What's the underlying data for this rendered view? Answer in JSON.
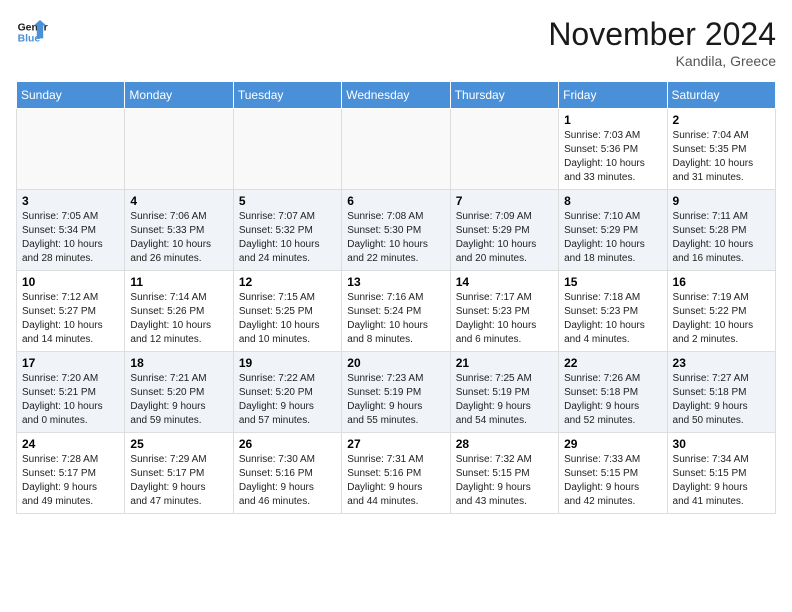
{
  "header": {
    "logo_line1": "General",
    "logo_line2": "Blue",
    "month_title": "November 2024",
    "location": "Kandila, Greece"
  },
  "days_of_week": [
    "Sunday",
    "Monday",
    "Tuesday",
    "Wednesday",
    "Thursday",
    "Friday",
    "Saturday"
  ],
  "weeks": [
    [
      {
        "day": "",
        "info": ""
      },
      {
        "day": "",
        "info": ""
      },
      {
        "day": "",
        "info": ""
      },
      {
        "day": "",
        "info": ""
      },
      {
        "day": "",
        "info": ""
      },
      {
        "day": "1",
        "info": "Sunrise: 7:03 AM\nSunset: 5:36 PM\nDaylight: 10 hours\nand 33 minutes."
      },
      {
        "day": "2",
        "info": "Sunrise: 7:04 AM\nSunset: 5:35 PM\nDaylight: 10 hours\nand 31 minutes."
      }
    ],
    [
      {
        "day": "3",
        "info": "Sunrise: 7:05 AM\nSunset: 5:34 PM\nDaylight: 10 hours\nand 28 minutes."
      },
      {
        "day": "4",
        "info": "Sunrise: 7:06 AM\nSunset: 5:33 PM\nDaylight: 10 hours\nand 26 minutes."
      },
      {
        "day": "5",
        "info": "Sunrise: 7:07 AM\nSunset: 5:32 PM\nDaylight: 10 hours\nand 24 minutes."
      },
      {
        "day": "6",
        "info": "Sunrise: 7:08 AM\nSunset: 5:30 PM\nDaylight: 10 hours\nand 22 minutes."
      },
      {
        "day": "7",
        "info": "Sunrise: 7:09 AM\nSunset: 5:29 PM\nDaylight: 10 hours\nand 20 minutes."
      },
      {
        "day": "8",
        "info": "Sunrise: 7:10 AM\nSunset: 5:29 PM\nDaylight: 10 hours\nand 18 minutes."
      },
      {
        "day": "9",
        "info": "Sunrise: 7:11 AM\nSunset: 5:28 PM\nDaylight: 10 hours\nand 16 minutes."
      }
    ],
    [
      {
        "day": "10",
        "info": "Sunrise: 7:12 AM\nSunset: 5:27 PM\nDaylight: 10 hours\nand 14 minutes."
      },
      {
        "day": "11",
        "info": "Sunrise: 7:14 AM\nSunset: 5:26 PM\nDaylight: 10 hours\nand 12 minutes."
      },
      {
        "day": "12",
        "info": "Sunrise: 7:15 AM\nSunset: 5:25 PM\nDaylight: 10 hours\nand 10 minutes."
      },
      {
        "day": "13",
        "info": "Sunrise: 7:16 AM\nSunset: 5:24 PM\nDaylight: 10 hours\nand 8 minutes."
      },
      {
        "day": "14",
        "info": "Sunrise: 7:17 AM\nSunset: 5:23 PM\nDaylight: 10 hours\nand 6 minutes."
      },
      {
        "day": "15",
        "info": "Sunrise: 7:18 AM\nSunset: 5:23 PM\nDaylight: 10 hours\nand 4 minutes."
      },
      {
        "day": "16",
        "info": "Sunrise: 7:19 AM\nSunset: 5:22 PM\nDaylight: 10 hours\nand 2 minutes."
      }
    ],
    [
      {
        "day": "17",
        "info": "Sunrise: 7:20 AM\nSunset: 5:21 PM\nDaylight: 10 hours\nand 0 minutes."
      },
      {
        "day": "18",
        "info": "Sunrise: 7:21 AM\nSunset: 5:20 PM\nDaylight: 9 hours\nand 59 minutes."
      },
      {
        "day": "19",
        "info": "Sunrise: 7:22 AM\nSunset: 5:20 PM\nDaylight: 9 hours\nand 57 minutes."
      },
      {
        "day": "20",
        "info": "Sunrise: 7:23 AM\nSunset: 5:19 PM\nDaylight: 9 hours\nand 55 minutes."
      },
      {
        "day": "21",
        "info": "Sunrise: 7:25 AM\nSunset: 5:19 PM\nDaylight: 9 hours\nand 54 minutes."
      },
      {
        "day": "22",
        "info": "Sunrise: 7:26 AM\nSunset: 5:18 PM\nDaylight: 9 hours\nand 52 minutes."
      },
      {
        "day": "23",
        "info": "Sunrise: 7:27 AM\nSunset: 5:18 PM\nDaylight: 9 hours\nand 50 minutes."
      }
    ],
    [
      {
        "day": "24",
        "info": "Sunrise: 7:28 AM\nSunset: 5:17 PM\nDaylight: 9 hours\nand 49 minutes."
      },
      {
        "day": "25",
        "info": "Sunrise: 7:29 AM\nSunset: 5:17 PM\nDaylight: 9 hours\nand 47 minutes."
      },
      {
        "day": "26",
        "info": "Sunrise: 7:30 AM\nSunset: 5:16 PM\nDaylight: 9 hours\nand 46 minutes."
      },
      {
        "day": "27",
        "info": "Sunrise: 7:31 AM\nSunset: 5:16 PM\nDaylight: 9 hours\nand 44 minutes."
      },
      {
        "day": "28",
        "info": "Sunrise: 7:32 AM\nSunset: 5:15 PM\nDaylight: 9 hours\nand 43 minutes."
      },
      {
        "day": "29",
        "info": "Sunrise: 7:33 AM\nSunset: 5:15 PM\nDaylight: 9 hours\nand 42 minutes."
      },
      {
        "day": "30",
        "info": "Sunrise: 7:34 AM\nSunset: 5:15 PM\nDaylight: 9 hours\nand 41 minutes."
      }
    ]
  ]
}
